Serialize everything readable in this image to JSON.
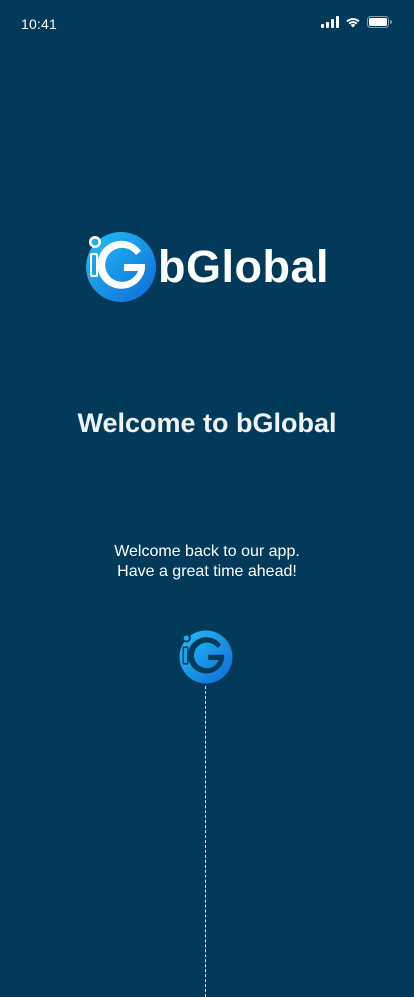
{
  "status_bar": {
    "time": "10:41",
    "icons": [
      "signal-icon",
      "wifi-icon",
      "battery-icon"
    ]
  },
  "logo": {
    "wordmark": "bGlobal",
    "mark_letter": "G",
    "colors": {
      "gradient_start": "#1fb4f0",
      "gradient_end": "#1272d8",
      "text": "#ffffff"
    }
  },
  "welcome": {
    "title": "Welcome to bGlobal",
    "subtitle_line1": "Welcome back to our app.",
    "subtitle_line2": "Have a great time ahead!"
  },
  "theme": {
    "background": "#033a5a"
  }
}
